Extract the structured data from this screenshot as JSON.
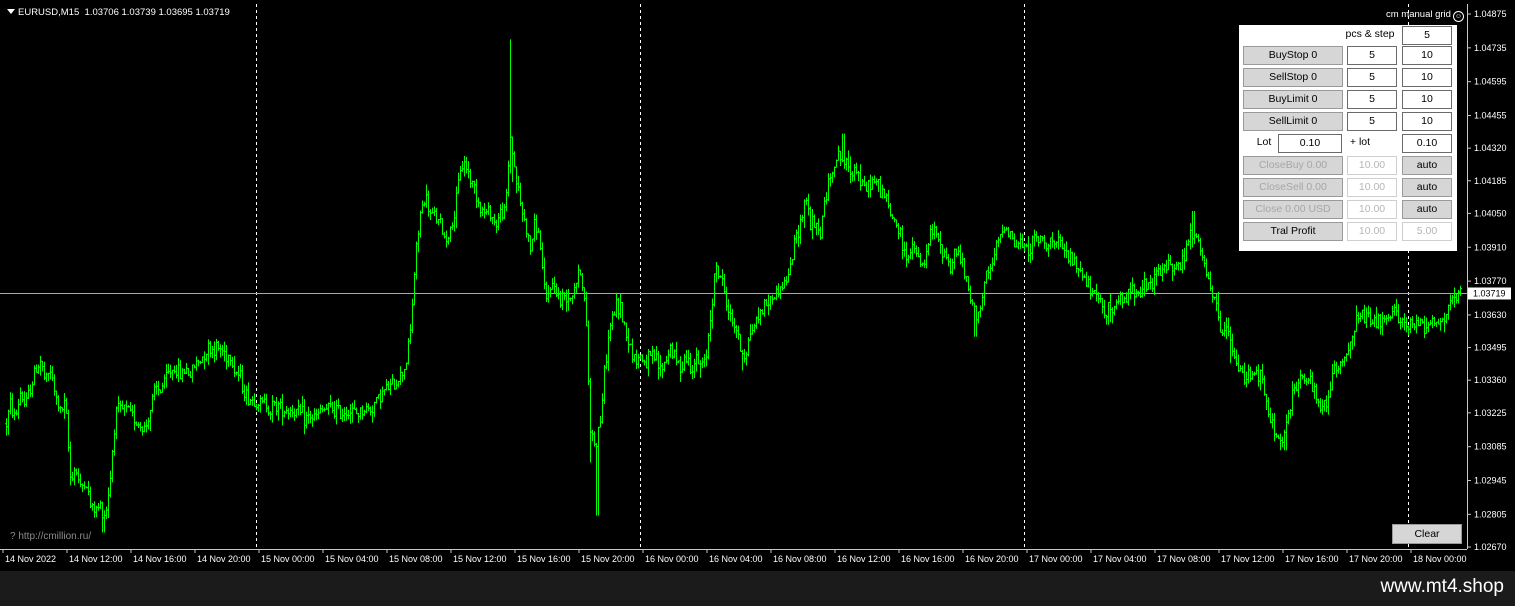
{
  "symbol": {
    "label": "EURUSD,M15",
    "ohlc": "1.03706 1.03739 1.03695 1.03719"
  },
  "indicator": {
    "name": "cm manual grid"
  },
  "chart_data": {
    "type": "bar",
    "series_color": "#00ff00",
    "background": "#000000",
    "current_price": 1.03719,
    "y_ticks": [
      "1.04875",
      "1.04735",
      "1.04595",
      "1.04455",
      "1.04320",
      "1.04185",
      "1.04050",
      "1.03910",
      "1.03770",
      "1.03630",
      "1.03495",
      "1.03360",
      "1.03225",
      "1.03085",
      "1.02945",
      "1.02805",
      "1.02670"
    ],
    "x_ticks": [
      "14 Nov 2022",
      "14 Nov 12:00",
      "14 Nov 16:00",
      "14 Nov 20:00",
      "15 Nov 00:00",
      "15 Nov 04:00",
      "15 Nov 08:00",
      "15 Nov 12:00",
      "15 Nov 16:00",
      "15 Nov 20:00",
      "16 Nov 00:00",
      "16 Nov 04:00",
      "16 Nov 08:00",
      "16 Nov 12:00",
      "16 Nov 16:00",
      "16 Nov 20:00",
      "17 Nov 00:00",
      "17 Nov 04:00",
      "17 Nov 08:00",
      "17 Nov 12:00",
      "17 Nov 16:00",
      "17 Nov 20:00",
      "18 Nov 00:00"
    ],
    "ylim": [
      1.0267,
      1.0488
    ],
    "day_separators": [
      "15 Nov 00:00",
      "16 Nov 00:00",
      "17 Nov 00:00",
      "18 Nov 00:00"
    ],
    "path_y": [
      [
        0,
        1.031
      ],
      [
        5,
        1.0316
      ],
      [
        10,
        1.0326
      ],
      [
        15,
        1.032
      ],
      [
        20,
        1.0331
      ],
      [
        25,
        1.0325
      ],
      [
        30,
        1.0333
      ],
      [
        35,
        1.034
      ],
      [
        40,
        1.0344
      ],
      [
        45,
        1.0335
      ],
      [
        50,
        1.034
      ],
      [
        55,
        1.0329
      ],
      [
        60,
        1.0323
      ],
      [
        65,
        1.0326
      ],
      [
        70,
        1.0296
      ],
      [
        75,
        1.03
      ],
      [
        80,
        1.0291
      ],
      [
        85,
        1.0295
      ],
      [
        90,
        1.0284
      ],
      [
        95,
        1.0282
      ],
      [
        100,
        1.0284
      ],
      [
        105,
        1.028
      ],
      [
        110,
        1.0296
      ],
      [
        115,
        1.0323
      ],
      [
        120,
        1.0323
      ],
      [
        125,
        1.0324
      ],
      [
        130,
        1.0322
      ],
      [
        135,
        1.032
      ],
      [
        140,
        1.0317
      ],
      [
        145,
        1.0316
      ],
      [
        150,
        1.0324
      ],
      [
        155,
        1.0332
      ],
      [
        160,
        1.0332
      ],
      [
        165,
        1.0336
      ],
      [
        170,
        1.034
      ],
      [
        175,
        1.0341
      ],
      [
        180,
        1.0338
      ],
      [
        185,
        1.0341
      ],
      [
        190,
        1.0338
      ],
      [
        195,
        1.0343
      ],
      [
        200,
        1.0344
      ],
      [
        205,
        1.0349
      ],
      [
        210,
        1.0349
      ],
      [
        215,
        1.0349
      ],
      [
        220,
        1.0349
      ],
      [
        225,
        1.0347
      ],
      [
        230,
        1.0346
      ],
      [
        235,
        1.034
      ],
      [
        240,
        1.0337
      ],
      [
        245,
        1.033
      ],
      [
        250,
        1.0328
      ],
      [
        255,
        1.0328
      ],
      [
        260,
        1.0326
      ],
      [
        265,
        1.0327
      ],
      [
        270,
        1.0324
      ],
      [
        275,
        1.0326
      ],
      [
        280,
        1.0325
      ],
      [
        285,
        1.0324
      ],
      [
        290,
        1.0324
      ],
      [
        295,
        1.0323
      ],
      [
        300,
        1.0322
      ],
      [
        305,
        1.032
      ],
      [
        310,
        1.0321
      ],
      [
        315,
        1.032
      ],
      [
        320,
        1.0323
      ],
      [
        325,
        1.0324
      ],
      [
        330,
        1.0324
      ],
      [
        335,
        1.0324
      ],
      [
        340,
        1.0322
      ],
      [
        345,
        1.0324
      ],
      [
        350,
        1.0323
      ],
      [
        355,
        1.0322
      ],
      [
        360,
        1.0323
      ],
      [
        365,
        1.0324
      ],
      [
        370,
        1.0324
      ],
      [
        375,
        1.0327
      ],
      [
        380,
        1.033
      ],
      [
        385,
        1.0332
      ],
      [
        390,
        1.0333
      ],
      [
        395,
        1.0335
      ],
      [
        400,
        1.0338
      ],
      [
        405,
        1.0342
      ],
      [
        410,
        1.0356
      ],
      [
        415,
        1.0386
      ],
      [
        420,
        1.0405
      ],
      [
        425,
        1.0412
      ],
      [
        430,
        1.0404
      ],
      [
        435,
        1.0404
      ],
      [
        440,
        1.04
      ],
      [
        445,
        1.0394
      ],
      [
        450,
        1.0398
      ],
      [
        455,
        1.0406
      ],
      [
        460,
        1.0424
      ],
      [
        465,
        1.0426
      ],
      [
        470,
        1.0419
      ],
      [
        475,
        1.0415
      ],
      [
        480,
        1.0407
      ],
      [
        485,
        1.0405
      ],
      [
        490,
        1.0406
      ],
      [
        495,
        1.04
      ],
      [
        500,
        1.0405
      ],
      [
        505,
        1.0406
      ],
      [
        510,
        1.0437
      ],
      [
        515,
        1.0421
      ],
      [
        520,
        1.0409
      ],
      [
        525,
        1.04
      ],
      [
        530,
        1.039
      ],
      [
        535,
        1.0402
      ],
      [
        540,
        1.0392
      ],
      [
        545,
        1.0367
      ],
      [
        550,
        1.0375
      ],
      [
        555,
        1.0375
      ],
      [
        560,
        1.0368
      ],
      [
        565,
        1.0372
      ],
      [
        570,
        1.0371
      ],
      [
        575,
        1.0376
      ],
      [
        580,
        1.0382
      ],
      [
        585,
        1.0366
      ],
      [
        590,
        1.0316
      ],
      [
        595,
        1.0309
      ],
      [
        600,
        1.032
      ],
      [
        605,
        1.0343
      ],
      [
        610,
        1.0359
      ],
      [
        615,
        1.0366
      ],
      [
        620,
        1.0366
      ],
      [
        625,
        1.0357
      ],
      [
        630,
        1.035
      ],
      [
        635,
        1.0344
      ],
      [
        640,
        1.0346
      ],
      [
        645,
        1.0343
      ],
      [
        650,
        1.0345
      ],
      [
        655,
        1.0345
      ],
      [
        660,
        1.034
      ],
      [
        665,
        1.0344
      ],
      [
        670,
        1.035
      ],
      [
        675,
        1.0344
      ],
      [
        680,
        1.0342
      ],
      [
        685,
        1.0346
      ],
      [
        690,
        1.0342
      ],
      [
        695,
        1.0344
      ],
      [
        700,
        1.0342
      ],
      [
        705,
        1.0343
      ],
      [
        710,
        1.0363
      ],
      [
        715,
        1.0382
      ],
      [
        720,
        1.0379
      ],
      [
        725,
        1.0371
      ],
      [
        730,
        1.0361
      ],
      [
        735,
        1.0359
      ],
      [
        740,
        1.0349
      ],
      [
        745,
        1.0346
      ],
      [
        750,
        1.0356
      ],
      [
        755,
        1.036
      ],
      [
        760,
        1.0364
      ],
      [
        765,
        1.0368
      ],
      [
        770,
        1.0369
      ],
      [
        775,
        1.0372
      ],
      [
        780,
        1.0374
      ],
      [
        785,
        1.0377
      ],
      [
        790,
        1.0382
      ],
      [
        795,
        1.0395
      ],
      [
        800,
        1.0401
      ],
      [
        805,
        1.0413
      ],
      [
        810,
        1.0401
      ],
      [
        815,
        1.0399
      ],
      [
        820,
        1.0397
      ],
      [
        825,
        1.0412
      ],
      [
        830,
        1.042
      ],
      [
        835,
        1.0428
      ],
      [
        840,
        1.0428
      ],
      [
        845,
        1.0425
      ],
      [
        850,
        1.0423
      ],
      [
        855,
        1.0425
      ],
      [
        860,
        1.0418
      ],
      [
        865,
        1.0414
      ],
      [
        870,
        1.0418
      ],
      [
        875,
        1.0418
      ],
      [
        880,
        1.0415
      ],
      [
        885,
        1.0412
      ],
      [
        890,
        1.0404
      ],
      [
        895,
        1.0402
      ],
      [
        900,
        1.0395
      ],
      [
        905,
        1.0387
      ],
      [
        910,
        1.0389
      ],
      [
        915,
        1.039
      ],
      [
        920,
        1.0383
      ],
      [
        925,
        1.0385
      ],
      [
        930,
        1.0396
      ],
      [
        935,
        1.0398
      ],
      [
        940,
        1.039
      ],
      [
        945,
        1.0389
      ],
      [
        950,
        1.0382
      ],
      [
        955,
        1.039
      ],
      [
        960,
        1.0387
      ],
      [
        965,
        1.0378
      ],
      [
        970,
        1.0369
      ],
      [
        975,
        1.0364
      ],
      [
        980,
        1.0366
      ],
      [
        985,
        1.0377
      ],
      [
        990,
        1.0381
      ],
      [
        995,
        1.0389
      ],
      [
        1000,
        1.0396
      ],
      [
        1005,
        1.0401
      ],
      [
        1010,
        1.0397
      ],
      [
        1015,
        1.0391
      ],
      [
        1020,
        1.0393
      ],
      [
        1025,
        1.039
      ],
      [
        1030,
        1.0392
      ],
      [
        1035,
        1.0394
      ],
      [
        1040,
        1.0394
      ],
      [
        1045,
        1.0393
      ],
      [
        1050,
        1.0394
      ],
      [
        1055,
        1.0391
      ],
      [
        1060,
        1.0392
      ],
      [
        1065,
        1.0388
      ],
      [
        1070,
        1.0386
      ],
      [
        1075,
        1.0383
      ],
      [
        1080,
        1.0382
      ],
      [
        1085,
        1.0377
      ],
      [
        1090,
        1.0373
      ],
      [
        1095,
        1.0369
      ],
      [
        1100,
        1.0369
      ],
      [
        1105,
        1.0365
      ],
      [
        1110,
        1.0365
      ],
      [
        1115,
        1.0366
      ],
      [
        1120,
        1.0369
      ],
      [
        1125,
        1.037
      ],
      [
        1130,
        1.0373
      ],
      [
        1135,
        1.0374
      ],
      [
        1140,
        1.0374
      ],
      [
        1145,
        1.0374
      ],
      [
        1150,
        1.0375
      ],
      [
        1155,
        1.0379
      ],
      [
        1160,
        1.038
      ],
      [
        1165,
        1.0383
      ],
      [
        1170,
        1.0385
      ],
      [
        1175,
        1.0383
      ],
      [
        1180,
        1.0383
      ],
      [
        1185,
        1.0389
      ],
      [
        1190,
        1.0396
      ],
      [
        1195,
        1.0395
      ],
      [
        1200,
        1.039
      ],
      [
        1205,
        1.0382
      ],
      [
        1210,
        1.0372
      ],
      [
        1215,
        1.0368
      ],
      [
        1220,
        1.0358
      ],
      [
        1225,
        1.0356
      ],
      [
        1230,
        1.0354
      ],
      [
        1235,
        1.0342
      ],
      [
        1240,
        1.034
      ],
      [
        1245,
        1.0337
      ],
      [
        1250,
        1.034
      ],
      [
        1255,
        1.034
      ],
      [
        1260,
        1.0337
      ],
      [
        1265,
        1.0328
      ],
      [
        1270,
        1.0319
      ],
      [
        1275,
        1.0314
      ],
      [
        1280,
        1.031
      ],
      [
        1285,
        1.0315
      ],
      [
        1290,
        1.0325
      ],
      [
        1295,
        1.0334
      ],
      [
        1300,
        1.0337
      ],
      [
        1305,
        1.0337
      ],
      [
        1310,
        1.0334
      ],
      [
        1315,
        1.0329
      ],
      [
        1320,
        1.0323
      ],
      [
        1325,
        1.0327
      ],
      [
        1330,
        1.0333
      ],
      [
        1335,
        1.0342
      ],
      [
        1340,
        1.0343
      ],
      [
        1345,
        1.0346
      ],
      [
        1350,
        1.0353
      ],
      [
        1355,
        1.0359
      ],
      [
        1360,
        1.0362
      ],
      [
        1365,
        1.0362
      ],
      [
        1370,
        1.0359
      ],
      [
        1375,
        1.0361
      ],
      [
        1380,
        1.036
      ],
      [
        1385,
        1.0359
      ],
      [
        1390,
        1.0362
      ],
      [
        1395,
        1.0364
      ],
      [
        1400,
        1.0362
      ],
      [
        1405,
        1.0358
      ],
      [
        1410,
        1.0359
      ],
      [
        1415,
        1.0358
      ],
      [
        1420,
        1.0361
      ],
      [
        1425,
        1.0359
      ],
      [
        1430,
        1.0361
      ],
      [
        1435,
        1.0359
      ],
      [
        1440,
        1.036
      ],
      [
        1445,
        1.0363
      ],
      [
        1450,
        1.0366
      ],
      [
        1455,
        1.0369
      ],
      [
        1460,
        1.0372
      ]
    ],
    "extremes": [
      [
        510,
        1.0477
      ],
      [
        512,
        1.0418
      ],
      [
        597,
        1.028
      ],
      [
        601,
        1.0318
      ],
      [
        590,
        1.0302
      ],
      [
        843,
        1.0438
      ],
      [
        1193,
        1.0406
      ],
      [
        1285,
        1.0307
      ],
      [
        103,
        1.0273
      ],
      [
        215,
        1.0352
      ],
      [
        975,
        1.0354
      ],
      [
        1110,
        1.036
      ],
      [
        1230,
        1.0343
      ],
      [
        742,
        1.034
      ],
      [
        700,
        1.0337
      ]
    ]
  },
  "panel": {
    "pcs_step_label": "pcs & step",
    "pcs_step_value": "5",
    "buystop": {
      "label": "BuyStop 0",
      "pcs": "5",
      "step": "10"
    },
    "sellstop": {
      "label": "SellStop 0",
      "pcs": "5",
      "step": "10"
    },
    "buylimit": {
      "label": "BuyLimit 0",
      "pcs": "5",
      "step": "10"
    },
    "selllimit": {
      "label": "SellLimit 0",
      "pcs": "5",
      "step": "10"
    },
    "lot_label": "Lot",
    "lot_value": "0.10",
    "plus_lot_label": "+ lot",
    "plus_lot_value": "0.10",
    "closebuy": {
      "label": "CloseBuy 0.00",
      "value": "10.00",
      "mode": "auto"
    },
    "closesell": {
      "label": "CloseSell 0.00",
      "value": "10.00",
      "mode": "auto"
    },
    "closeusd": {
      "label": "Close 0.00 USD",
      "value": "10.00",
      "mode": "auto"
    },
    "tral": {
      "label": "Tral Profit",
      "value1": "10.00",
      "value2": "5.00"
    }
  },
  "url_label": "? http://cmillion.ru/",
  "clear_label": "Clear",
  "footer_text": "www.mt4.shop"
}
